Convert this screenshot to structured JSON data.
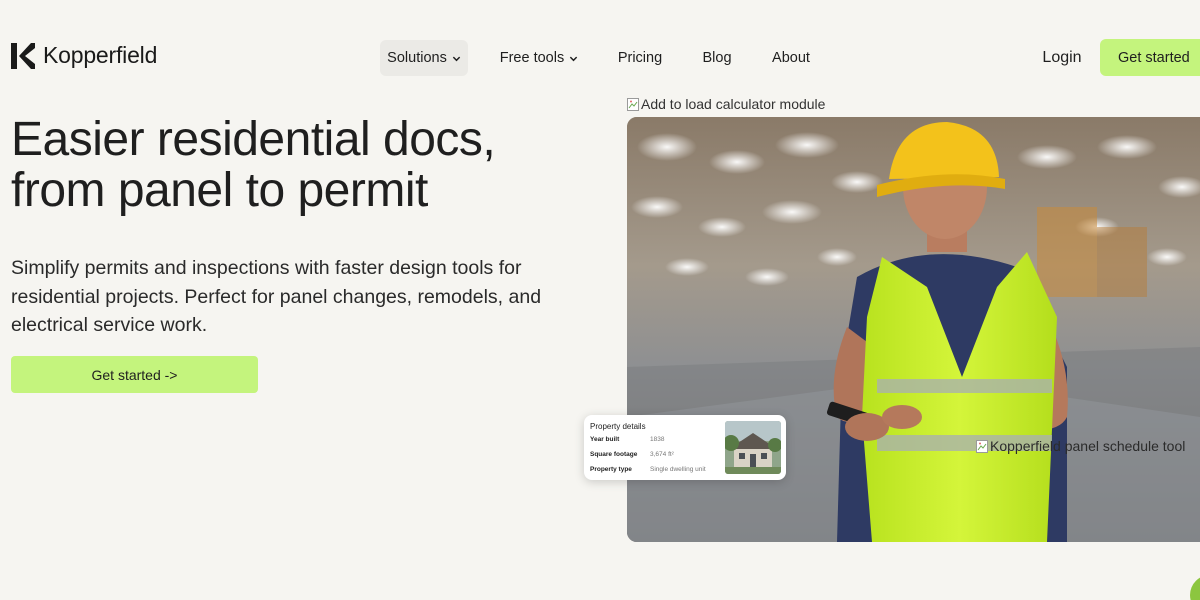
{
  "brand": {
    "name": "Kopperfield",
    "logo_icon": "k-logo-icon"
  },
  "nav": {
    "items": [
      {
        "label": "Solutions",
        "has_dropdown": true,
        "active": true
      },
      {
        "label": "Free tools",
        "has_dropdown": true,
        "active": false
      },
      {
        "label": "Pricing",
        "has_dropdown": false,
        "active": false
      },
      {
        "label": "Blog",
        "has_dropdown": false,
        "active": false
      },
      {
        "label": "About",
        "has_dropdown": false,
        "active": false
      }
    ],
    "login_label": "Login",
    "cta_label": "Get started"
  },
  "hero": {
    "title_line1": "Easier residential docs,",
    "title_line2": "from panel to permit",
    "subtitle": "Simplify permits and inspections with faster design tools for residential projects. Perfect for panel changes, remodels, and electrical service work.",
    "cta_label": "Get started ->"
  },
  "media": {
    "top_image_alt": "Add to load calculator module",
    "bottom_image_alt": "Kopperfield panel schedule tool"
  },
  "property_card": {
    "title": "Property details",
    "rows": [
      {
        "label": "Year built",
        "value": "1838"
      },
      {
        "label": "Square footage",
        "value": "3,674 ft²"
      },
      {
        "label": "Property type",
        "value": "Single dwelling unit"
      }
    ]
  },
  "colors": {
    "background": "#f6f5f1",
    "accent_green": "#c4f47d",
    "text": "#1f1f1f",
    "nav_active_bg": "#ebeae6",
    "vest_yellow": "#c9f227",
    "helmet_yellow": "#f3c21b"
  }
}
